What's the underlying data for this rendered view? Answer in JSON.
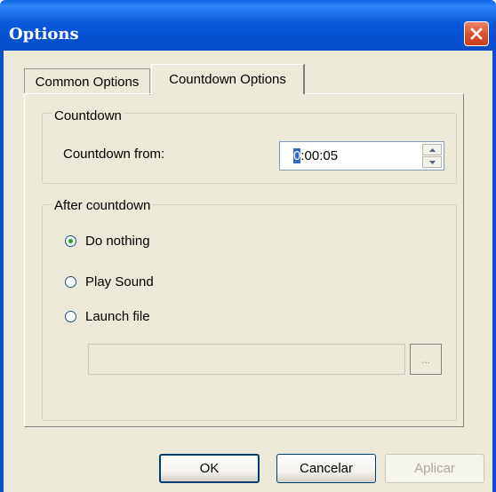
{
  "window": {
    "title": "Options",
    "close_icon": "close-icon"
  },
  "tabs": [
    {
      "label": "Common Options",
      "active": false
    },
    {
      "label": "Countdown Options",
      "active": true
    }
  ],
  "countdown_group": {
    "legend": "Countdown",
    "from_label": "Countdown from:",
    "value_selected": "0",
    "value_rest": ":00:05"
  },
  "after_group": {
    "legend": "After countdown",
    "options": [
      {
        "label": "Do nothing",
        "checked": true
      },
      {
        "label": "Play Sound",
        "checked": false
      },
      {
        "label": "Launch file",
        "checked": false
      }
    ],
    "file_value": "",
    "browse_label": "..."
  },
  "buttons": {
    "ok": "OK",
    "cancel": "Cancelar",
    "apply": "Aplicar"
  },
  "colors": {
    "titlebar": "#0a58dc",
    "dialog_bg": "#ece9d8",
    "selection": "#316ac5",
    "close_red": "#d9532e"
  }
}
